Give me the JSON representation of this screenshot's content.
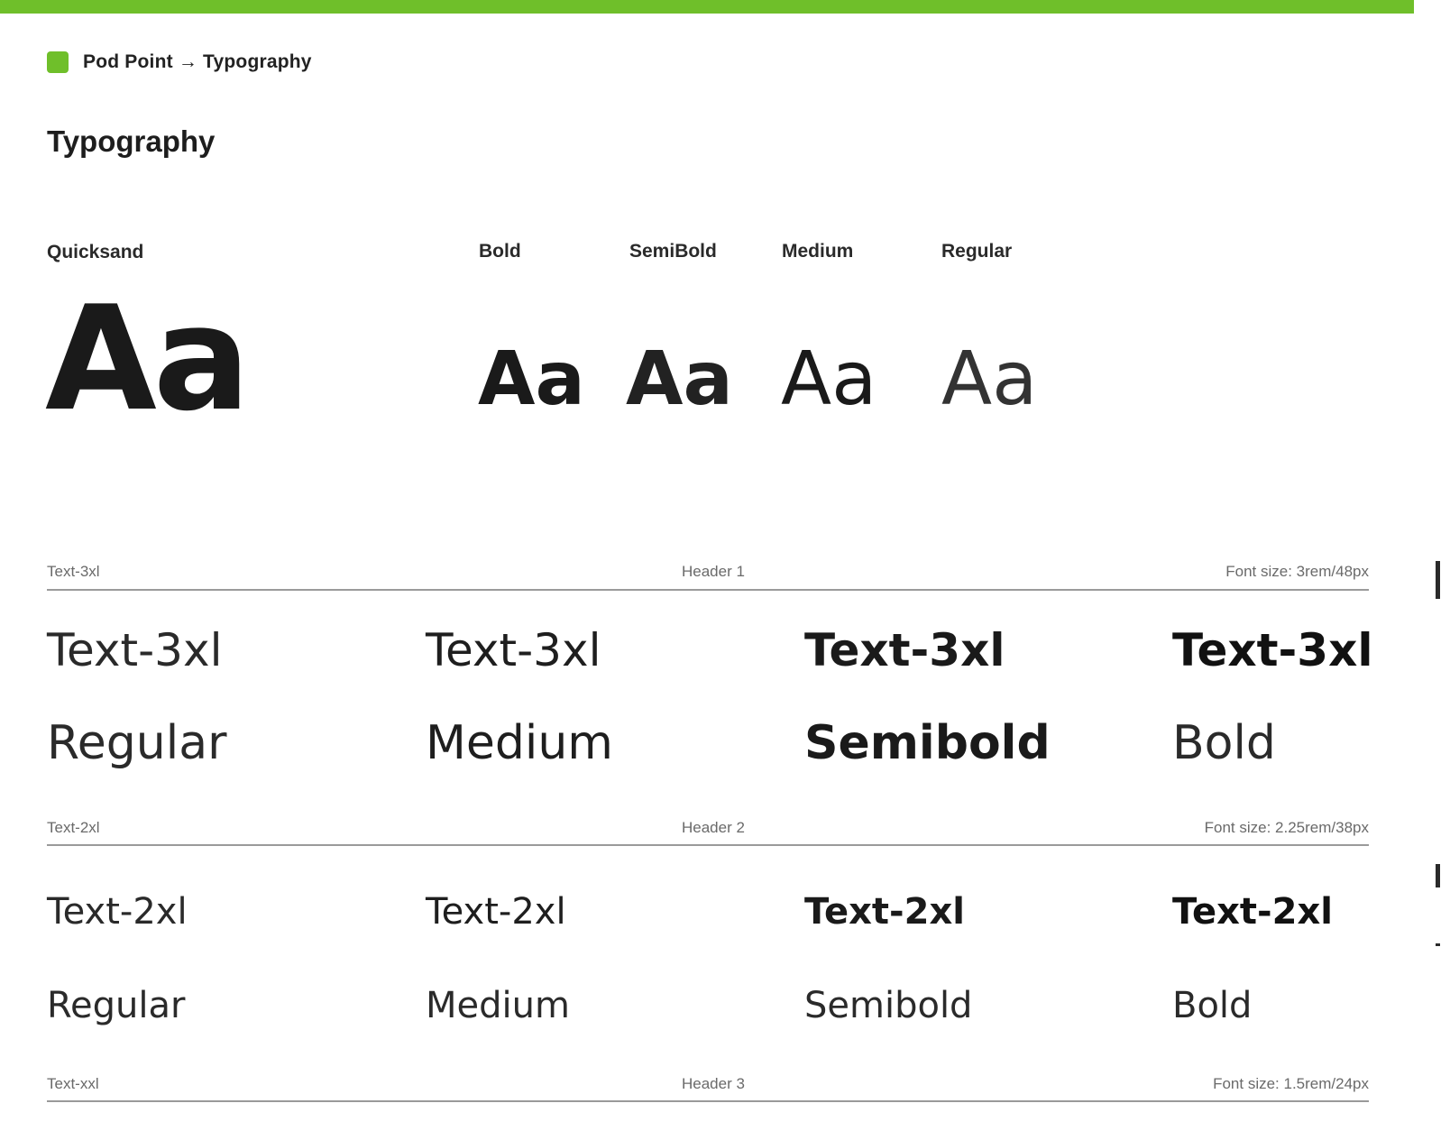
{
  "colors": {
    "accent": "#6fbf2a",
    "rule": "#9a9a9a",
    "text": "#1a1a1a"
  },
  "breadcrumb": {
    "text": "Pod Point → Typography"
  },
  "title": "Typography",
  "font_family_label": "Quicksand",
  "font_sample": "Aa",
  "weights": [
    {
      "label": "Bold",
      "sample": "Aa"
    },
    {
      "label": "SemiBold",
      "sample": "Aa"
    },
    {
      "label": "Medium",
      "sample": "Aa"
    },
    {
      "label": "Regular",
      "sample": "Aa"
    }
  ],
  "sections": [
    {
      "token": "Text-3xl",
      "role": "Header 1",
      "size_note": "Font size: 3rem/48px",
      "samples": [
        "Text-3xl",
        "Text-3xl",
        "Text-3xl",
        "Text-3xl"
      ],
      "weight_names": [
        "Regular",
        "Medium",
        "Semibold",
        "Bold"
      ]
    },
    {
      "token": "Text-2xl",
      "role": "Header 2",
      "size_note": "Font size: 2.25rem/38px",
      "samples": [
        "Text-2xl",
        "Text-2xl",
        "Text-2xl",
        "Text-2xl"
      ],
      "weight_names": [
        "Regular",
        "Medium",
        "Semibold",
        "Bold"
      ]
    },
    {
      "token": "Text-xxl",
      "role": "Header 3",
      "size_note": "Font size: 1.5rem/24px"
    }
  ]
}
